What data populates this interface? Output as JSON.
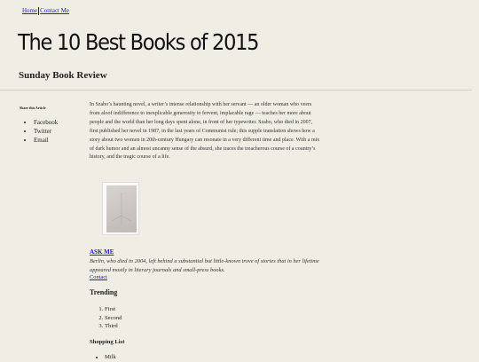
{
  "nav": {
    "home": "Home",
    "contact": "Contact Me"
  },
  "page": {
    "title": "The 10 Best Books of 2015",
    "subtitle": "Sunday Book Review"
  },
  "share": {
    "heading": "Share this Article",
    "items": [
      "Facebook",
      "Twitter",
      "Email"
    ]
  },
  "article": {
    "body": "In Szabo’s haunting novel, a writer’s intense relationship with her servant — an older woman who veers from aloof indifference to inexplicable generosity to fervent, implacable rage — teaches her more about people and the world than her long days spent alone, in front of her typewriter. Szabo, who died in 2007, first published her novel in 1987, in the last years of Communist rule; this supple translation shows how a story about two women in 20th-century Hungary can resonate in a very different time and place. With a mix of dark humor and an almost uncanny sense of the absurd, she traces the treacherous course of a country’s history, and the tragic course of a life."
  },
  "ask": {
    "label": "ASK ME",
    "body": "Berlin, who died in 2004, left behind a substantial but little-known trove of stories that in her lifetime appeared mostly in literary journals and small-press books.",
    "contact": "Contact"
  },
  "trending": {
    "heading": "Trending",
    "items": [
      "First",
      "Second",
      "Third"
    ]
  },
  "shopping": {
    "heading": "Shopping List",
    "items": [
      "Milk"
    ]
  }
}
